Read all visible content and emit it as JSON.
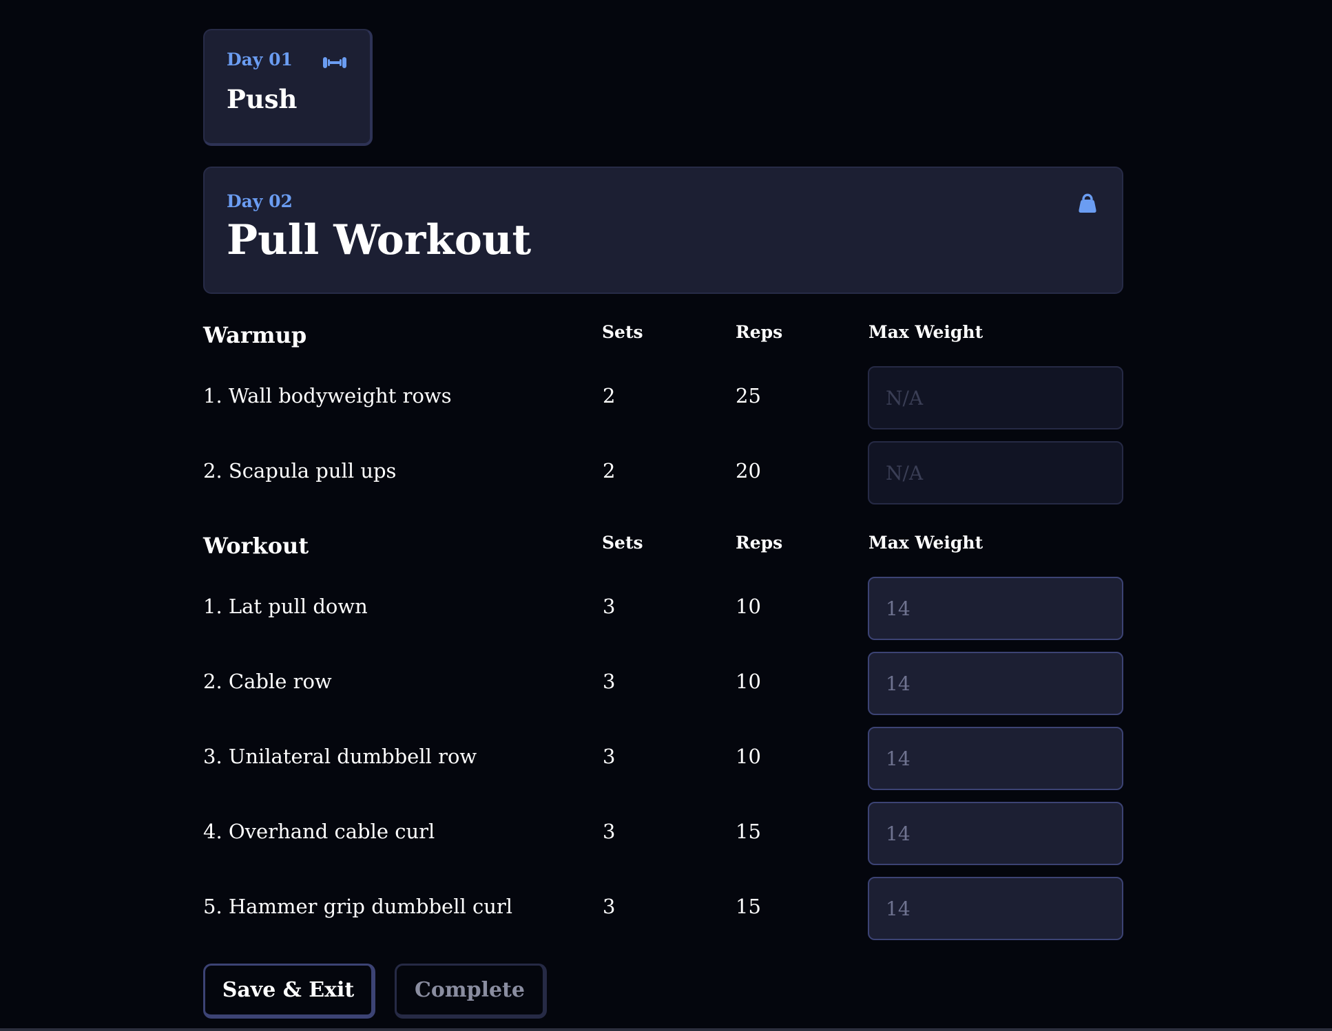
{
  "colors": {
    "background": "#04060d",
    "card": "#1c1f33",
    "card_border": "#272b47",
    "accent": "#6b9df2",
    "text": "#ffffff",
    "muted": "#8a8da0"
  },
  "prev_day": {
    "day_label": "Day 01",
    "title": "Push",
    "icon": "dumbbell-icon"
  },
  "current_day": {
    "day_label": "Day 02",
    "title": "Pull Workout",
    "icon": "kettlebell-icon"
  },
  "warmup": {
    "title": "Warmup",
    "col_sets": "Sets",
    "col_reps": "Reps",
    "col_weight": "Max Weight",
    "rows": [
      {
        "name": "1. Wall bodyweight rows",
        "sets": "2",
        "reps": "25",
        "placeholder": "N/A"
      },
      {
        "name": "2. Scapula pull ups",
        "sets": "2",
        "reps": "20",
        "placeholder": "N/A"
      }
    ]
  },
  "workout": {
    "title": "Workout",
    "col_sets": "Sets",
    "col_reps": "Reps",
    "col_weight": "Max Weight",
    "rows": [
      {
        "name": "1. Lat pull down",
        "sets": "3",
        "reps": "10",
        "placeholder": "14"
      },
      {
        "name": "2. Cable row",
        "sets": "3",
        "reps": "10",
        "placeholder": "14"
      },
      {
        "name": "3. Unilateral dumbbell row",
        "sets": "3",
        "reps": "10",
        "placeholder": "14"
      },
      {
        "name": "4. Overhand cable curl",
        "sets": "3",
        "reps": "15",
        "placeholder": "14"
      },
      {
        "name": "5. Hammer grip dumbbell curl",
        "sets": "3",
        "reps": "15",
        "placeholder": "14"
      }
    ]
  },
  "buttons": {
    "save_exit": "Save & Exit",
    "complete": "Complete"
  }
}
